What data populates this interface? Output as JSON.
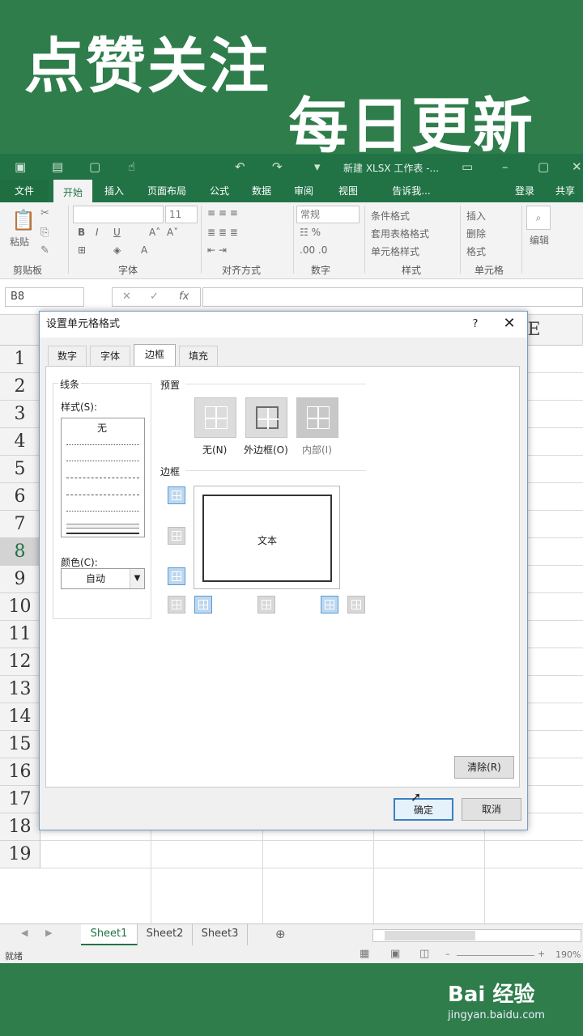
{
  "banner": {
    "line1": "点赞关注",
    "line2": "每日更新"
  },
  "window": {
    "doc_title": "新建 XLSX 工作表 -..."
  },
  "ribbon": {
    "tabs": [
      "文件",
      "开始",
      "插入",
      "页面布局",
      "公式",
      "数据",
      "审阅",
      "视图",
      "告诉我...",
      "登录",
      "共享"
    ],
    "active_tab": "开始",
    "groups": [
      "剪贴板",
      "字体",
      "对齐方式",
      "数字",
      "样式",
      "单元格"
    ],
    "paste_label": "粘贴",
    "font_size": "11",
    "number_format": "常规",
    "styles_items": [
      "条件格式",
      "套用表格格式",
      "单元格样式"
    ],
    "cells_items": [
      "插入",
      "删除",
      "格式"
    ],
    "edit_label": "编辑"
  },
  "formula_bar": {
    "name_box": "B8",
    "fx": "fx"
  },
  "grid": {
    "columns": [
      "E"
    ],
    "rows": [
      "1",
      "2",
      "3",
      "4",
      "5",
      "6",
      "7",
      "8",
      "9",
      "10",
      "11",
      "12",
      "13",
      "14",
      "15",
      "16",
      "17",
      "18",
      "19"
    ],
    "selected_row": "8"
  },
  "sheets": {
    "tabs": [
      "Sheet1",
      "Sheet2",
      "Sheet3"
    ],
    "active": "Sheet1"
  },
  "status": {
    "text": "就绪",
    "zoom": "190%"
  },
  "dialog": {
    "title": "设置单元格格式",
    "help": "?",
    "close": "✕",
    "tabs": [
      "数字",
      "字体",
      "边框",
      "填充"
    ],
    "active_tab": "边框",
    "line_section": "线条",
    "style_label": "样式(S):",
    "style_none": "无",
    "color_label": "颜色(C):",
    "color_value": "自动",
    "preset_section": "预置",
    "presets": [
      "无(N)",
      "外边框(O)",
      "内部(I)"
    ],
    "border_section": "边框",
    "preview_text": "文本",
    "clear_button": "清除(R)",
    "ok_button": "确定",
    "cancel_button": "取消"
  },
  "watermark": {
    "brand": "Bai 经验",
    "url": "jingyan.baidu.com"
  }
}
